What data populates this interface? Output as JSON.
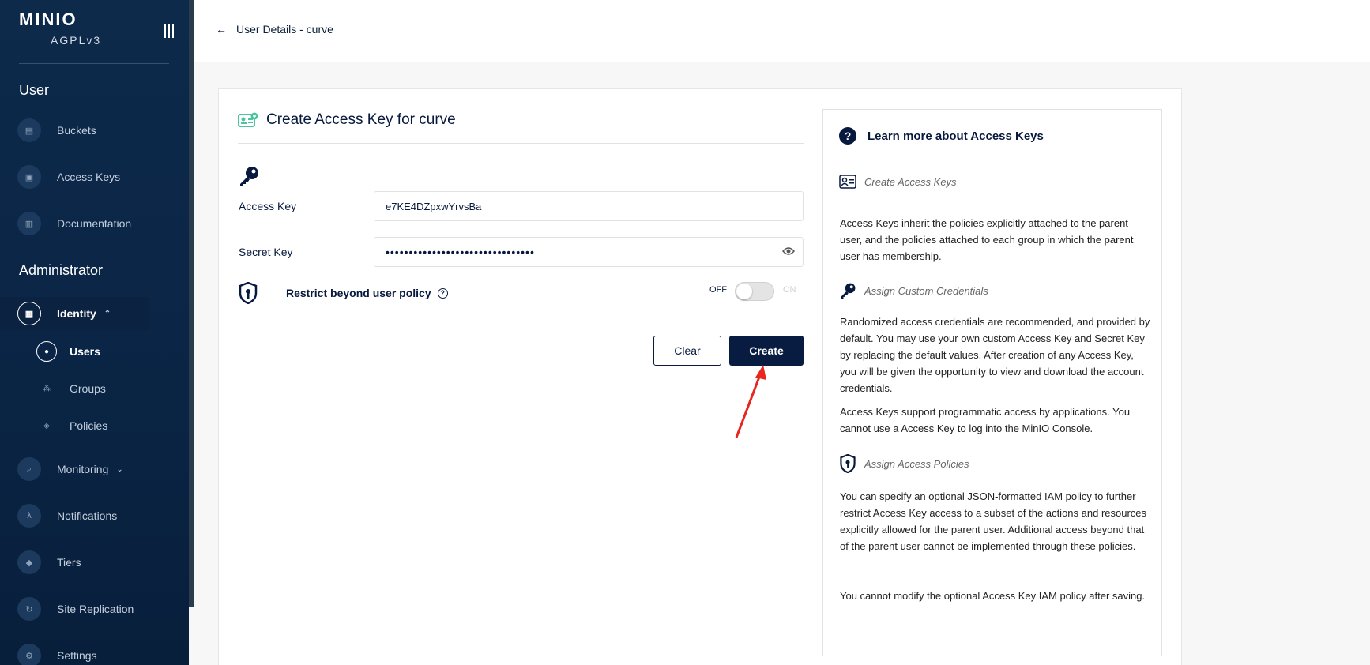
{
  "sidebar": {
    "logo": "MINIO",
    "edition": "AGPLv3",
    "section_user": "User",
    "section_admin": "Administrator",
    "items": {
      "buckets": "Buckets",
      "access_keys": "Access Keys",
      "documentation": "Documentation",
      "identity": "Identity",
      "users": "Users",
      "groups": "Groups",
      "policies": "Policies",
      "monitoring": "Monitoring",
      "notifications": "Notifications",
      "tiers": "Tiers",
      "site_replication": "Site Replication",
      "settings": "Settings"
    }
  },
  "header": {
    "back_label": "User Details - curve"
  },
  "form": {
    "title": "Create Access Key for curve",
    "access_key_label": "Access Key",
    "access_key_value": "e7KE4DZpxwYrvsBa",
    "secret_key_label": "Secret Key",
    "secret_key_masked": "••••••••••••••••••••••••••••••••",
    "restrict_label": "Restrict beyond user policy",
    "toggle_off": "OFF",
    "toggle_on": "ON",
    "toggle_state": false,
    "clear_label": "Clear",
    "create_label": "Create"
  },
  "help": {
    "title": "Learn more about Access Keys",
    "create_heading": "Create Access Keys",
    "create_text": "Access Keys inherit the policies explicitly attached to the parent user, and the policies attached to each group in which the parent user has membership.",
    "custom_heading": "Assign Custom Credentials",
    "custom_text_1": "Randomized access credentials are recommended, and provided by default. You may use your own custom Access Key and Secret Key by replacing the default values. After creation of any Access Key, you will be given the opportunity to view and download the account credentials.",
    "custom_text_2": "Access Keys support programmatic access by applications. You cannot use a Access Key to log into the MinIO Console.",
    "policies_heading": "Assign Access Policies",
    "policies_text_1": "You can specify an optional JSON-formatted IAM policy to further restrict Access Key access to a subset of the actions and resources explicitly allowed for the parent user. Additional access beyond that of the parent user cannot be implemented through these policies.",
    "policies_text_2": "You cannot modify the optional Access Key IAM policy after saving."
  },
  "colors": {
    "sidebar_bg": "#0d2a4b",
    "primary": "#081c42",
    "accent_green": "#4cc4a0",
    "annotation_arrow": "#e8261f"
  }
}
